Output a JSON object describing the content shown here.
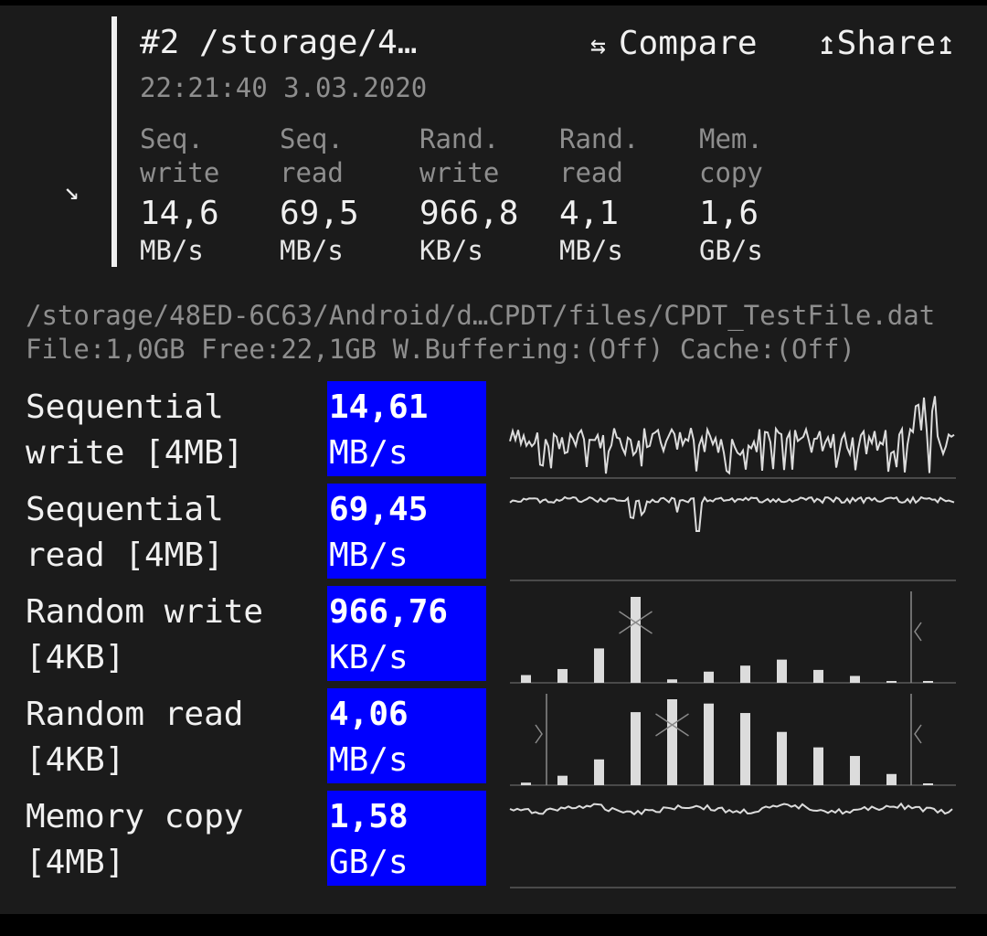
{
  "header": {
    "title": "#2 /storage/4…",
    "timestamp": "22:21:40 3.03.2020",
    "compare_glyph": "⇆",
    "compare_label": "Compare",
    "share_label": "↥Share↥",
    "expand_glyph": "↘"
  },
  "summary": [
    {
      "label": "Seq.\nwrite",
      "value": "14,6",
      "unit": "MB/s"
    },
    {
      "label": "Seq.\nread",
      "value": "69,5",
      "unit": "MB/s"
    },
    {
      "label": "Rand.\nwrite",
      "value": "966,8",
      "unit": "KB/s"
    },
    {
      "label": "Rand.\nread",
      "value": "4,1",
      "unit": "MB/s"
    },
    {
      "label": "Mem.\ncopy",
      "value": "1,6",
      "unit": "GB/s"
    }
  ],
  "file": {
    "path": "/storage/48ED-6C63/Android/d…CPDT/files/CPDT_TestFile.dat",
    "info": "File:1,0GB Free:22,1GB W.Buffering:(Off) Cache:(Off)"
  },
  "tests": [
    {
      "name": "Sequential\nwrite [4MB]",
      "value": "14,61",
      "unit": "MB/s",
      "graph": "sequential-write"
    },
    {
      "name": "Sequential\nread [4MB]",
      "value": "69,45",
      "unit": "MB/s",
      "graph": "sequential-read"
    },
    {
      "name": "Random write\n[4KB]",
      "value": "966,76",
      "unit": "KB/s",
      "graph": "random-write"
    },
    {
      "name": "Random read\n[4KB]",
      "value": "4,06",
      "unit": "MB/s",
      "graph": "random-read"
    },
    {
      "name": "Memory copy\n[4MB]",
      "value": "1,58",
      "unit": "GB/s",
      "graph": "memory-copy"
    }
  ],
  "colors": {
    "background": "#1b1b1b",
    "result_box": "#0000ff",
    "graph_line": "#dcdcdc",
    "baseline": "#4a4a4a"
  },
  "icons": {
    "expand": "arrow-down-right-icon",
    "compare": "swap-arrows-icon",
    "share": "share-arrows-icon"
  },
  "histograms": {
    "random_write_bars": [
      0.09,
      0.16,
      0.4,
      1.0,
      0.04,
      0.13,
      0.2,
      0.27,
      0.15,
      0.08,
      0.02,
      0.01
    ],
    "random_read_bars": [
      0.03,
      0.11,
      0.3,
      0.85,
      1.0,
      0.95,
      0.84,
      0.62,
      0.44,
      0.34,
      0.13,
      0.02
    ]
  }
}
